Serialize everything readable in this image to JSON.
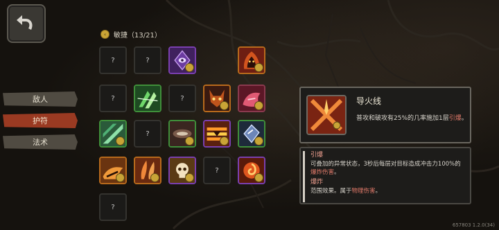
{
  "nav": {
    "back_icon": "back-arrow-icon"
  },
  "tabs": [
    {
      "label": "敌人",
      "active": false
    },
    {
      "label": "护符",
      "active": true
    },
    {
      "label": "法术",
      "active": false
    }
  ],
  "category": {
    "label": "敏捷（13/21）"
  },
  "grid": {
    "unknown_label": "?",
    "rows": [
      [
        "?",
        "?",
        "purple-eye-charm",
        "fire-demon-charm"
      ],
      [
        "?",
        "green-claw-charm",
        "?",
        "horned-mask-charm",
        "red-beast-charm"
      ],
      [
        "green-slash-charm",
        "?",
        "blade-charm",
        "flame-stripe-charm",
        "shield-charm"
      ],
      [
        "orange-beast-charm",
        "feather-charm",
        "skull-charm",
        "?",
        "fire-swirl-charm"
      ],
      [
        "?"
      ]
    ]
  },
  "detail": {
    "title": "导火线",
    "desc_prefix": "普攻和破攻有25%的几率施加1层",
    "desc_keyword": "引爆",
    "desc_suffix": "。",
    "icon": "fuse-charm-icon"
  },
  "notes": {
    "term1": "引爆",
    "term1_line1": "可叠加的异常状态，3秒后每层对目标造成冲击力100%的",
    "term1_line2_kw": "爆炸伤害",
    "term1_line2_end": "。",
    "term2": "爆炸",
    "term2_line_prefix": "范围效果。属于",
    "term2_line_kw": "物理伤害",
    "term2_line_end": "。"
  },
  "version": "657803 1.2.0(34)",
  "colors": {
    "accent_red": "#9a3a22",
    "highlight": "#e27a6a",
    "badge_gold": "#c9a436"
  }
}
